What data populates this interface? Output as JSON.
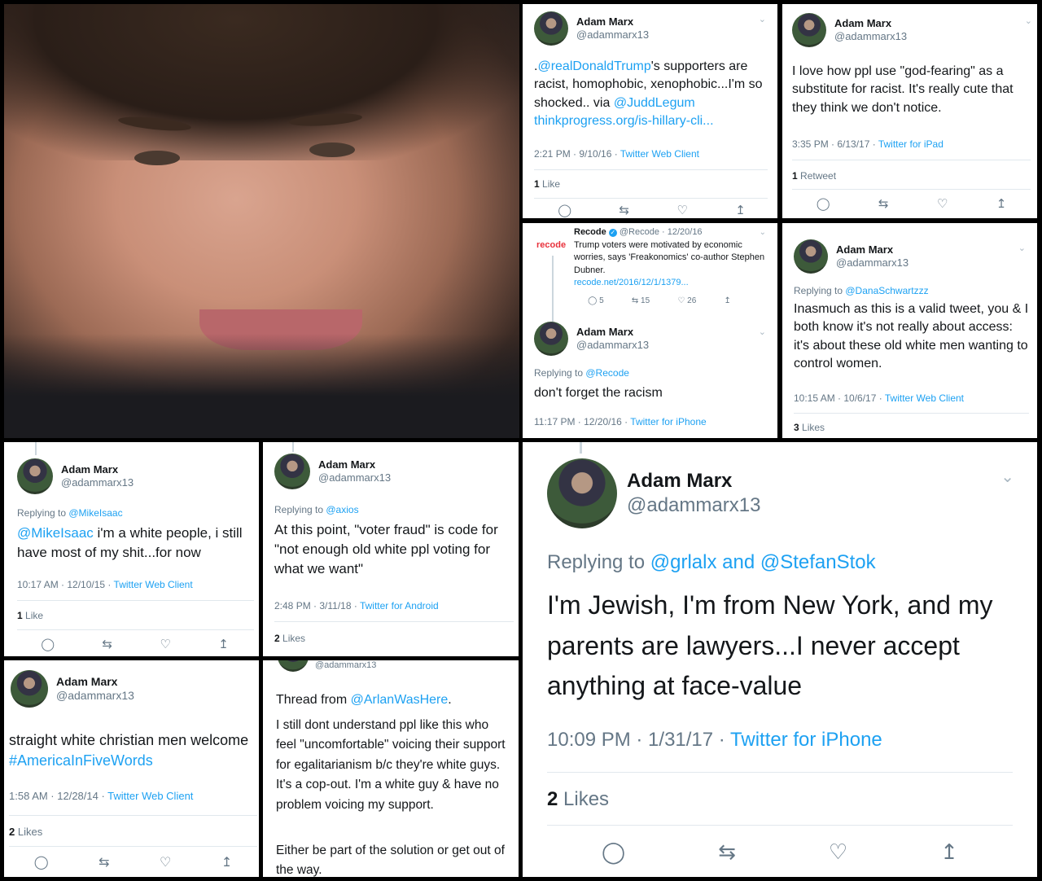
{
  "accent": "#1da1f2",
  "icons": [
    "reply-icon",
    "retweet-icon",
    "like-icon",
    "share-icon",
    "chevron-down-icon",
    "verified-icon"
  ],
  "author": {
    "name": "Adam Marx",
    "handle": "@adammarx13"
  },
  "t1": {
    "text_a": ".",
    "mention": "@realDonaldTrump",
    "text_b": "'s supporters are racist, homophobic, xenophobic...I'm so shocked.. via ",
    "mention2": "@JuddLegum",
    "url": "thinkprogress.org/is-hillary-cli...",
    "time": "2:21 PM · 9/10/16 · ",
    "client": "Twitter Web Client",
    "stat_num": "1",
    "stat_label": "Like"
  },
  "t2": {
    "text": "I love how ppl use \"god-fearing\" as a substitute for racist. It's really cute that they think we don't notice.",
    "time": "3:35 PM · 6/13/17 · ",
    "client": "Twitter for iPad",
    "stat_num": "1",
    "stat_label": "Retweet"
  },
  "t3": {
    "quoted_name": "Recode",
    "quoted_handle": "@Recode · 12/20/16",
    "logo": "recode",
    "quoted_text": "Trump voters were motivated by economic worries, says 'Freakonomics' co-author Stephen Dubner.",
    "quoted_url": "recode.net/2016/12/1/1379...",
    "q_replies": "5",
    "q_retweets": "15",
    "q_likes": "26",
    "reply_prefix": "Replying to ",
    "reply_to": "@Recode",
    "text": "don't forget the racism",
    "time": "11:17 PM · 12/20/16 · ",
    "client": "Twitter for iPhone"
  },
  "t4": {
    "reply_prefix": "Replying to ",
    "reply_to": "@DanaSchwartzzz",
    "text": "Inasmuch as this is a valid tweet, you & I both know it's not really about access: it's about these old white men wanting to control women.",
    "time": "10:15 AM · 10/6/17 · ",
    "client": "Twitter Web Client",
    "stat_num": "3",
    "stat_label": "Likes"
  },
  "t5": {
    "reply_prefix": "Replying to ",
    "reply_to": "@MikeIsaac",
    "mention": "@MikeIsaac",
    "text": " i'm a white people, i still have most of my shit...for now",
    "time": "10:17 AM · 12/10/15 · ",
    "client": "Twitter Web Client",
    "stat_num": "1",
    "stat_label": "Like"
  },
  "t6": {
    "reply_prefix": "Replying to ",
    "reply_to": "@axios",
    "text": "At this point, \"voter fraud\" is code for \"not enough old white ppl voting for what we want\"",
    "time": "2:48 PM · 3/11/18 · ",
    "client": "Twitter for Android",
    "stat_num": "2",
    "stat_label": "Likes"
  },
  "t7": {
    "reply_prefix": "Replying to ",
    "reply_to": "@grlalx and @StefanStok",
    "text": "I'm Jewish, I'm from New York, and my parents are lawyers...I never accept anything at face-value",
    "time": "10:09 PM · 1/31/17 · ",
    "client": "Twitter for iPhone",
    "stat_num": "2",
    "stat_label": "Likes"
  },
  "t8": {
    "text": "straight white christian men welcome",
    "hashtag": "#AmericaInFiveWords",
    "time": "1:58 AM · 12/28/14 · ",
    "client": "Twitter Web Client",
    "stat_num": "2",
    "stat_label": "Likes"
  },
  "t9": {
    "handle": "@adammarx13",
    "thread_prefix": "Thread from ",
    "thread_from": "@ArlanWasHere",
    "thread_suffix": ".",
    "text": "I still dont understand ppl like this who feel \"uncomfortable\" voicing their support for egalitarianism b/c they're white guys. It's a cop-out. I'm a white guy & have no problem voicing my support.",
    "text2": "Either be part of the solution or get out of the way."
  }
}
